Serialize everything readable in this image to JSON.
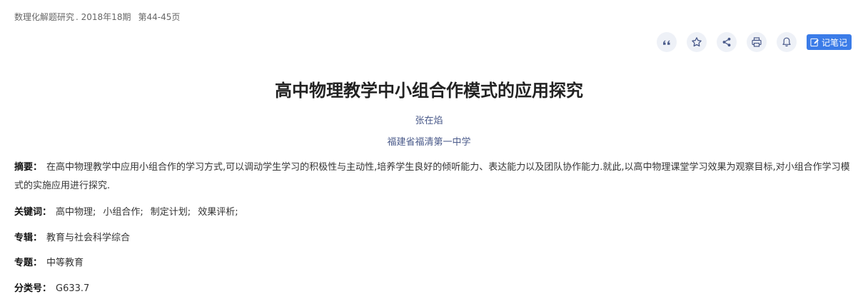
{
  "source": {
    "journal": "数理化解题研究",
    "issue": ". 2018年18期",
    "pages": "第44-45页"
  },
  "toolbar": {
    "icons": [
      "quote-icon",
      "star-icon",
      "share-icon",
      "print-icon",
      "bell-icon"
    ],
    "note_label": "记笔记",
    "accent_color": "#3b7ce8"
  },
  "article": {
    "title": "高中物理教学中小组合作模式的应用探究",
    "author": "张在焰",
    "organization": "福建省福清第一中学"
  },
  "abstract": {
    "label": "摘要：",
    "text": "在高中物理教学中应用小组合作的学习方式,可以调动学生学习的积极性与主动性,培养学生良好的倾听能力、表达能力以及团队协作能力.就此,以高中物理课堂学习效果为观察目标,对小组合作学习模式的实施应用进行探究."
  },
  "keywords": {
    "label": "关键词：",
    "items": [
      "高中物理;",
      "小组合作;",
      "制定计划;",
      "效果评析;"
    ]
  },
  "album": {
    "label": "专辑：",
    "value": "教育与社会科学综合"
  },
  "topic": {
    "label": "专题：",
    "value": "中等教育"
  },
  "classification": {
    "label": "分类号：",
    "value": "G633.7"
  }
}
